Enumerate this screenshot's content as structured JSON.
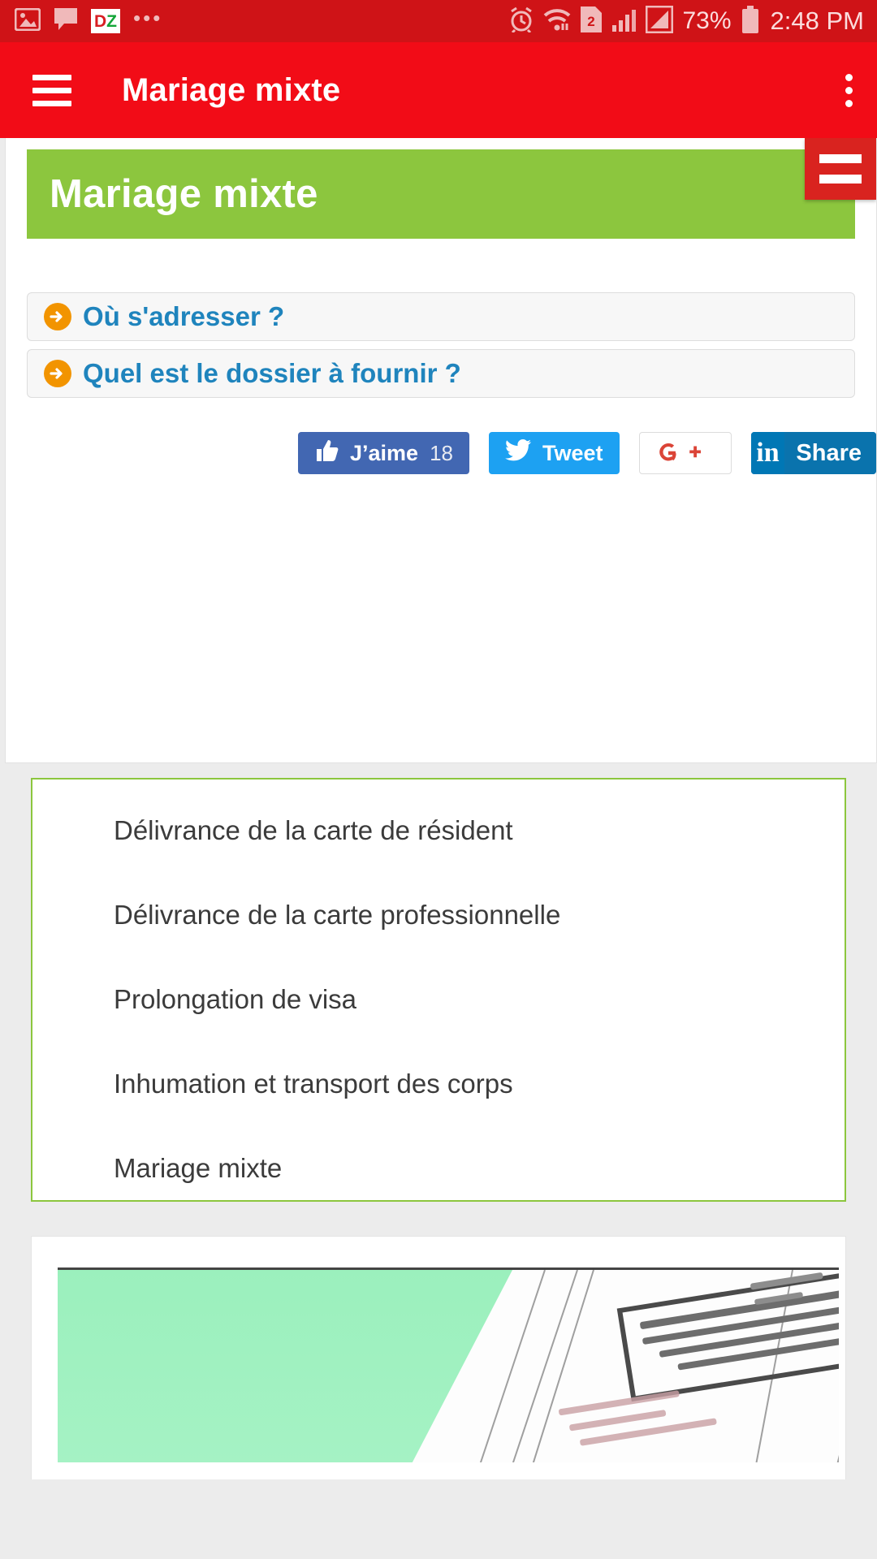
{
  "statusbar": {
    "icons": [
      "image-icon",
      "message-icon",
      "dz-app-icon",
      "overflow-dots-icon",
      "alarm-icon",
      "wifi-icon",
      "sim2-icon",
      "signal-icon",
      "signal2-icon"
    ],
    "dz_left": "D",
    "dz_right": "Z",
    "dots": "•••",
    "battery_percent": "73%",
    "time": "2:48 PM"
  },
  "appbar": {
    "title": "Mariage mixte",
    "menu_icon": "hamburger-icon",
    "overflow_icon": "kebab-menu-icon"
  },
  "webview": {
    "float_menu_icon": "floating-menu-icon",
    "banner_title": "Mariage mixte",
    "accordions": [
      {
        "label": "Où s'adresser ?",
        "icon": "arrow-right-circle-icon"
      },
      {
        "label": "Quel est le dossier à fournir ?",
        "icon": "arrow-right-circle-icon"
      }
    ],
    "social": {
      "facebook": {
        "label": "J’aime",
        "count": "18",
        "icon": "thumbs-up-icon"
      },
      "twitter": {
        "label": "Tweet",
        "icon": "twitter-bird-icon"
      },
      "google": {
        "label": "G+",
        "icon": "google-plus-icon"
      },
      "linkedin": {
        "label": "Share",
        "mark": "in",
        "icon": "linkedin-icon"
      }
    },
    "list_items": [
      "Délivrance de la carte de résident",
      "Délivrance de la carte professionnelle",
      "Prolongation de visa",
      "Inhumation et transport des corps",
      "Mariage mixte"
    ],
    "document_preview_icon": "document-scan-image"
  },
  "colors": {
    "status_bar": "#cf1317",
    "app_bar": "#f20c17",
    "banner_green": "#8cc63e",
    "link_blue": "#1f84bd",
    "arrow_orange": "#f29400",
    "facebook_blue": "#4267b2",
    "twitter_blue": "#1da1f2",
    "linkedin_blue": "#0077b5",
    "google_red": "#db4437"
  }
}
